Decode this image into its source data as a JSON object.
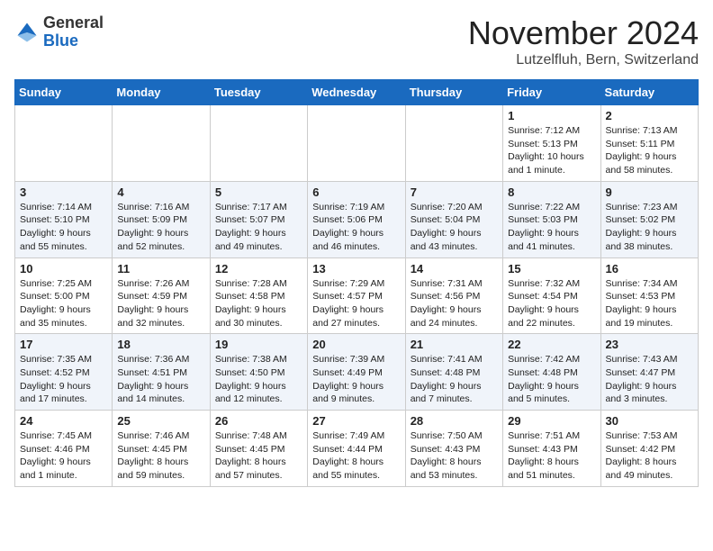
{
  "logo": {
    "general": "General",
    "blue": "Blue"
  },
  "title": "November 2024",
  "location": "Lutzelfluh, Bern, Switzerland",
  "days_of_week": [
    "Sunday",
    "Monday",
    "Tuesday",
    "Wednesday",
    "Thursday",
    "Friday",
    "Saturday"
  ],
  "weeks": [
    [
      {
        "day": "",
        "info": ""
      },
      {
        "day": "",
        "info": ""
      },
      {
        "day": "",
        "info": ""
      },
      {
        "day": "",
        "info": ""
      },
      {
        "day": "",
        "info": ""
      },
      {
        "day": "1",
        "info": "Sunrise: 7:12 AM\nSunset: 5:13 PM\nDaylight: 10 hours and 1 minute."
      },
      {
        "day": "2",
        "info": "Sunrise: 7:13 AM\nSunset: 5:11 PM\nDaylight: 9 hours and 58 minutes."
      }
    ],
    [
      {
        "day": "3",
        "info": "Sunrise: 7:14 AM\nSunset: 5:10 PM\nDaylight: 9 hours and 55 minutes."
      },
      {
        "day": "4",
        "info": "Sunrise: 7:16 AM\nSunset: 5:09 PM\nDaylight: 9 hours and 52 minutes."
      },
      {
        "day": "5",
        "info": "Sunrise: 7:17 AM\nSunset: 5:07 PM\nDaylight: 9 hours and 49 minutes."
      },
      {
        "day": "6",
        "info": "Sunrise: 7:19 AM\nSunset: 5:06 PM\nDaylight: 9 hours and 46 minutes."
      },
      {
        "day": "7",
        "info": "Sunrise: 7:20 AM\nSunset: 5:04 PM\nDaylight: 9 hours and 43 minutes."
      },
      {
        "day": "8",
        "info": "Sunrise: 7:22 AM\nSunset: 5:03 PM\nDaylight: 9 hours and 41 minutes."
      },
      {
        "day": "9",
        "info": "Sunrise: 7:23 AM\nSunset: 5:02 PM\nDaylight: 9 hours and 38 minutes."
      }
    ],
    [
      {
        "day": "10",
        "info": "Sunrise: 7:25 AM\nSunset: 5:00 PM\nDaylight: 9 hours and 35 minutes."
      },
      {
        "day": "11",
        "info": "Sunrise: 7:26 AM\nSunset: 4:59 PM\nDaylight: 9 hours and 32 minutes."
      },
      {
        "day": "12",
        "info": "Sunrise: 7:28 AM\nSunset: 4:58 PM\nDaylight: 9 hours and 30 minutes."
      },
      {
        "day": "13",
        "info": "Sunrise: 7:29 AM\nSunset: 4:57 PM\nDaylight: 9 hours and 27 minutes."
      },
      {
        "day": "14",
        "info": "Sunrise: 7:31 AM\nSunset: 4:56 PM\nDaylight: 9 hours and 24 minutes."
      },
      {
        "day": "15",
        "info": "Sunrise: 7:32 AM\nSunset: 4:54 PM\nDaylight: 9 hours and 22 minutes."
      },
      {
        "day": "16",
        "info": "Sunrise: 7:34 AM\nSunset: 4:53 PM\nDaylight: 9 hours and 19 minutes."
      }
    ],
    [
      {
        "day": "17",
        "info": "Sunrise: 7:35 AM\nSunset: 4:52 PM\nDaylight: 9 hours and 17 minutes."
      },
      {
        "day": "18",
        "info": "Sunrise: 7:36 AM\nSunset: 4:51 PM\nDaylight: 9 hours and 14 minutes."
      },
      {
        "day": "19",
        "info": "Sunrise: 7:38 AM\nSunset: 4:50 PM\nDaylight: 9 hours and 12 minutes."
      },
      {
        "day": "20",
        "info": "Sunrise: 7:39 AM\nSunset: 4:49 PM\nDaylight: 9 hours and 9 minutes."
      },
      {
        "day": "21",
        "info": "Sunrise: 7:41 AM\nSunset: 4:48 PM\nDaylight: 9 hours and 7 minutes."
      },
      {
        "day": "22",
        "info": "Sunrise: 7:42 AM\nSunset: 4:48 PM\nDaylight: 9 hours and 5 minutes."
      },
      {
        "day": "23",
        "info": "Sunrise: 7:43 AM\nSunset: 4:47 PM\nDaylight: 9 hours and 3 minutes."
      }
    ],
    [
      {
        "day": "24",
        "info": "Sunrise: 7:45 AM\nSunset: 4:46 PM\nDaylight: 9 hours and 1 minute."
      },
      {
        "day": "25",
        "info": "Sunrise: 7:46 AM\nSunset: 4:45 PM\nDaylight: 8 hours and 59 minutes."
      },
      {
        "day": "26",
        "info": "Sunrise: 7:48 AM\nSunset: 4:45 PM\nDaylight: 8 hours and 57 minutes."
      },
      {
        "day": "27",
        "info": "Sunrise: 7:49 AM\nSunset: 4:44 PM\nDaylight: 8 hours and 55 minutes."
      },
      {
        "day": "28",
        "info": "Sunrise: 7:50 AM\nSunset: 4:43 PM\nDaylight: 8 hours and 53 minutes."
      },
      {
        "day": "29",
        "info": "Sunrise: 7:51 AM\nSunset: 4:43 PM\nDaylight: 8 hours and 51 minutes."
      },
      {
        "day": "30",
        "info": "Sunrise: 7:53 AM\nSunset: 4:42 PM\nDaylight: 8 hours and 49 minutes."
      }
    ]
  ]
}
